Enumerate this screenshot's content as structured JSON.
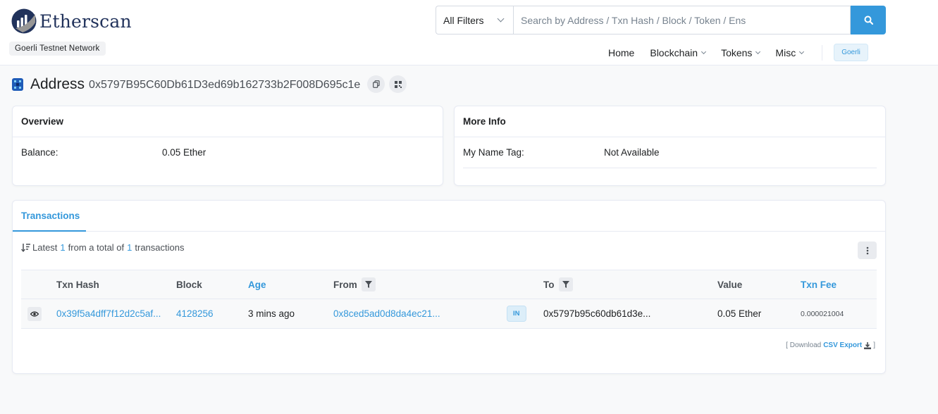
{
  "brand": {
    "name": "Etherscan",
    "network_badge": "Goerli Testnet Network"
  },
  "search": {
    "filter_label": "All Filters",
    "placeholder": "Search by Address / Txn Hash / Block / Token / Ens"
  },
  "nav": {
    "home": "Home",
    "blockchain": "Blockchain",
    "tokens": "Tokens",
    "misc": "Misc",
    "network": "Goerli"
  },
  "address": {
    "title": "Address",
    "value": "0x5797B95C60Db61D3ed69b162733b2F008D695c1e"
  },
  "overview": {
    "heading": "Overview",
    "balance_label": "Balance:",
    "balance_value": "0.05 Ether"
  },
  "more_info": {
    "heading": "More Info",
    "name_tag_label": "My Name Tag:",
    "name_tag_value": "Not Available"
  },
  "transactions": {
    "tab_label": "Transactions",
    "summary_prefix": "Latest",
    "summary_count": "1",
    "summary_mid": "from a total of",
    "summary_total": "1",
    "summary_suffix": "transactions",
    "columns": {
      "hash": "Txn Hash",
      "block": "Block",
      "age": "Age",
      "from": "From",
      "to": "To",
      "value": "Value",
      "fee": "Txn Fee"
    },
    "rows": [
      {
        "hash": "0x39f5a4dff7f12d2c5af...",
        "block": "4128256",
        "age": "3 mins ago",
        "from": "0x8ced5ad0d8da4ec21...",
        "direction": "IN",
        "to": "0x5797b95c60db61d3e...",
        "value": "0.05 Ether",
        "fee": "0.000021004"
      }
    ],
    "export": {
      "open": "[ Download",
      "link": "CSV Export",
      "close": "]"
    }
  },
  "colors": {
    "accent": "#3498db",
    "brand_navy": "#21325b",
    "background": "#f8f9fa"
  }
}
